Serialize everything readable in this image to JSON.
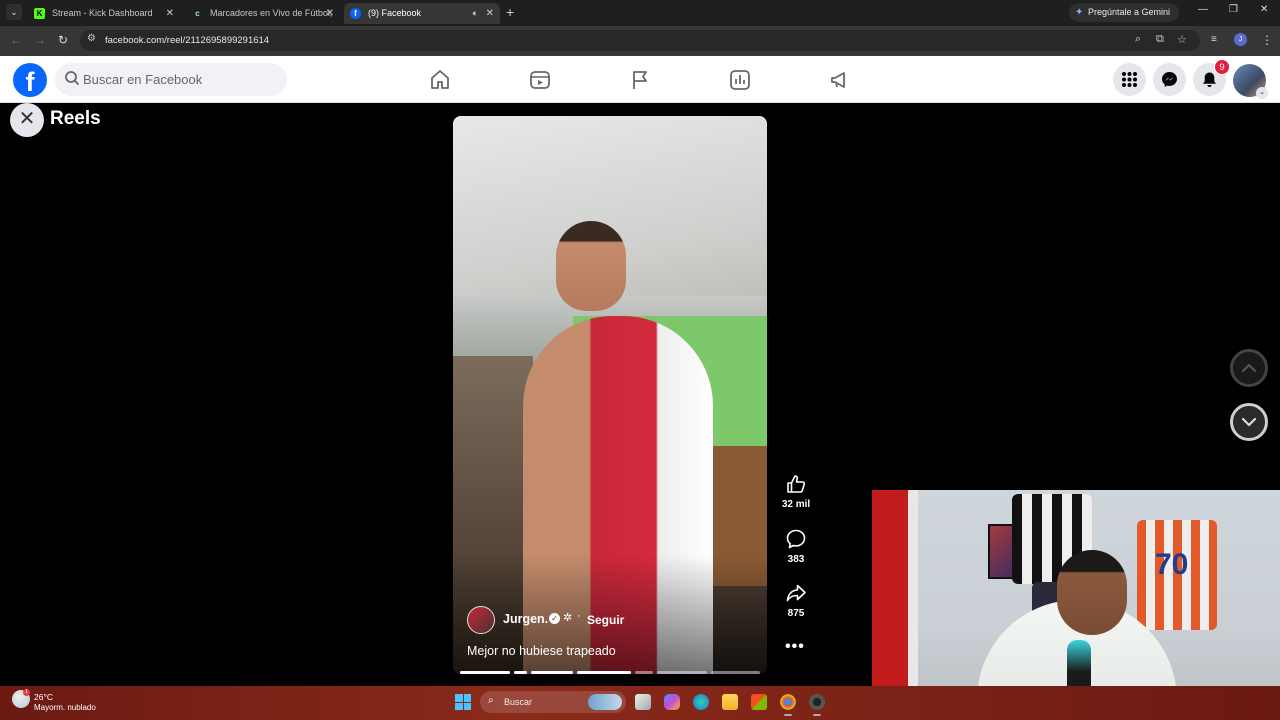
{
  "browser": {
    "tabs": [
      {
        "title": "Stream - Kick Dashboard",
        "favicon": "K"
      },
      {
        "title": "Marcadores en Vivo de Fútbol,",
        "favicon": "c"
      },
      {
        "title": "(9) Facebook",
        "favicon": "f"
      }
    ],
    "gemini_label": "Pregúntale a Gemini",
    "url": "facebook.com/reel/2112695899291614",
    "profile_initial": "J"
  },
  "facebook": {
    "search_placeholder": "Buscar en Facebook",
    "notification_count": "9",
    "reels_title": "Reels",
    "reel": {
      "author": "Jurgen.",
      "follow_label": "Seguir",
      "caption": "Mejor no hubiese trapeado",
      "likes": "32 mil",
      "comments": "383",
      "shares": "875"
    }
  },
  "taskbar": {
    "temperature": "26°C",
    "weather": "Mayorm. nublado",
    "search_label": "Buscar"
  },
  "colors": {
    "facebook_blue": "#0866ff",
    "notification_red": "#e41e3f",
    "taskbar": "#8a2a1a"
  }
}
